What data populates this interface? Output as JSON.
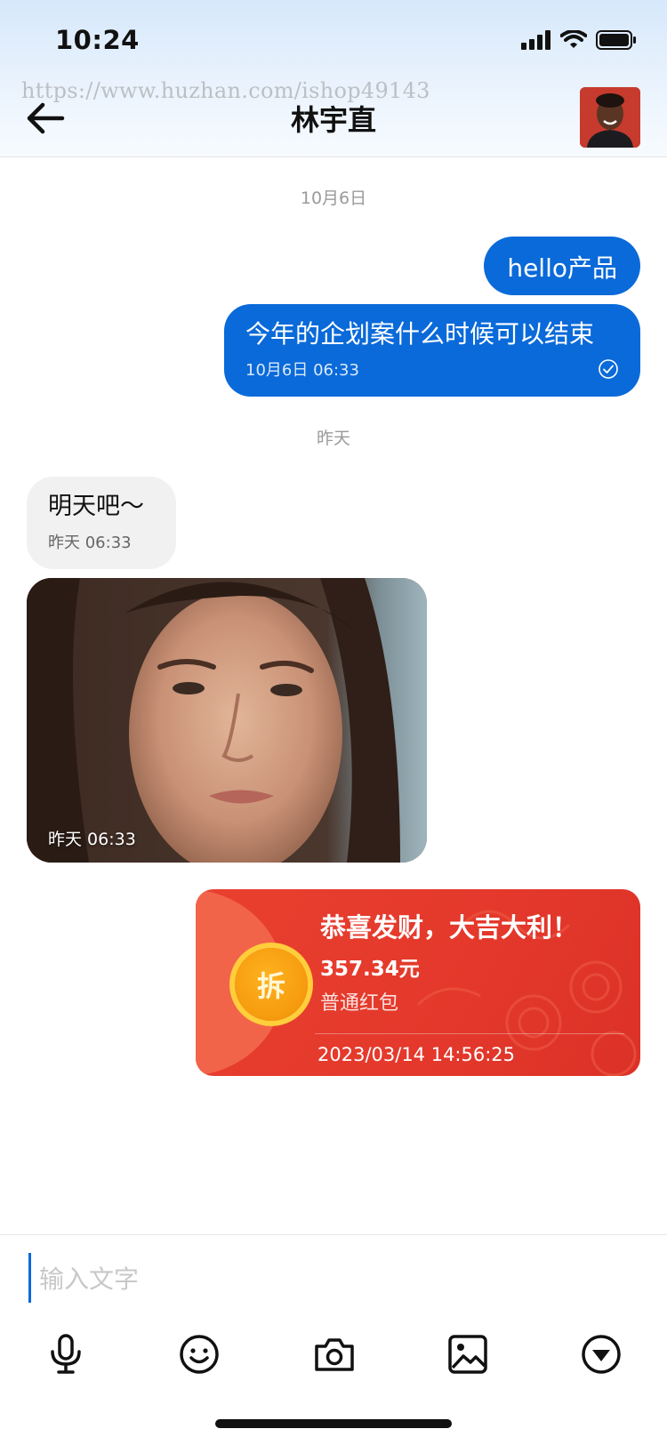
{
  "status_bar": {
    "time": "10:24"
  },
  "watermark": "https://www.huzhan.com/ishop49143",
  "header": {
    "title": "林宇直",
    "back_icon": "arrow-left-icon"
  },
  "messages": {
    "date1": "10月6日",
    "out1": {
      "text": "hello产品"
    },
    "out2": {
      "text": "今年的企划案什么时候可以结束",
      "time": "10月6日 06:33"
    },
    "date2": "昨天",
    "in1": {
      "text": "明天吧～",
      "time": "昨天 06:33"
    },
    "photo": {
      "time": "昨天 06:33"
    },
    "red_packet": {
      "title": "恭喜发财，大吉大利！",
      "amount": "357.34元",
      "type": "普通红包",
      "coin_label": "拆",
      "time": "2023/03/14 14:56:25"
    }
  },
  "input": {
    "placeholder": "输入文字",
    "value": ""
  },
  "toolbar_icons": [
    "microphone-icon",
    "emoji-icon",
    "camera-icon",
    "image-icon",
    "dropdown-circle-icon"
  ],
  "colors": {
    "accent": "#0a6ad9",
    "red_packet": "#e3382b",
    "coin": "#f59a0e"
  }
}
